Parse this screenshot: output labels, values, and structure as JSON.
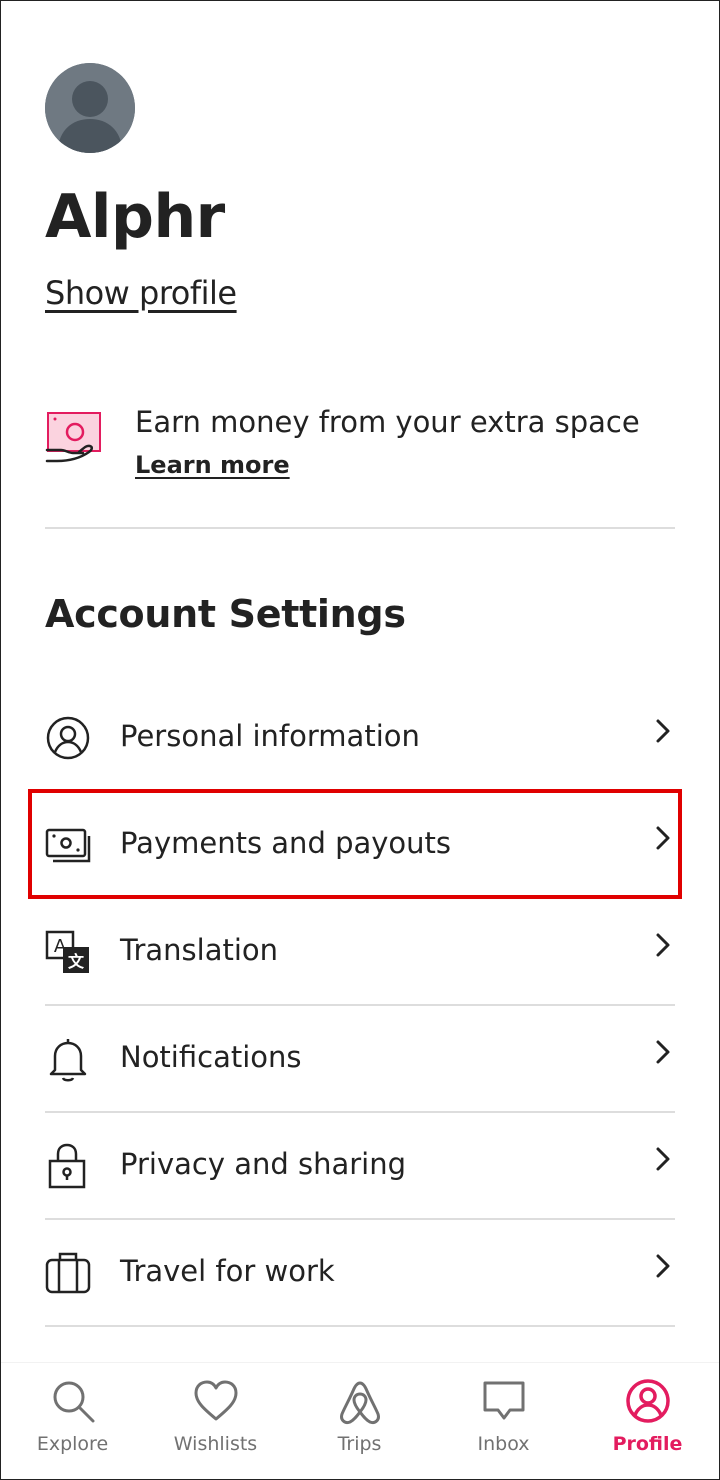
{
  "profile": {
    "name": "Alphr",
    "show_profile": "Show profile"
  },
  "promo": {
    "text": "Earn money from your extra space",
    "link": "Learn more",
    "icon": "hosting-money-icon"
  },
  "account_settings": {
    "title": "Account Settings",
    "items": [
      {
        "label": "Personal information",
        "icon": "user-circle-icon"
      },
      {
        "label": "Payments and payouts",
        "icon": "money-icon",
        "highlighted": true
      },
      {
        "label": "Translation",
        "icon": "translate-icon"
      },
      {
        "label": "Notifications",
        "icon": "bell-icon"
      },
      {
        "label": "Privacy and sharing",
        "icon": "lock-icon"
      },
      {
        "label": "Travel for work",
        "icon": "briefcase-icon"
      }
    ]
  },
  "tabbar": {
    "items": [
      {
        "label": "Explore",
        "icon": "search-icon"
      },
      {
        "label": "Wishlists",
        "icon": "heart-icon"
      },
      {
        "label": "Trips",
        "icon": "airbnb-logo-icon"
      },
      {
        "label": "Inbox",
        "icon": "chat-icon"
      },
      {
        "label": "Profile",
        "icon": "profile-icon",
        "active": true
      }
    ]
  },
  "colors": {
    "accent": "#e31c5f",
    "highlight_box": "#e00000",
    "text": "#222222",
    "muted": "#717171",
    "divider": "#dddddd"
  }
}
